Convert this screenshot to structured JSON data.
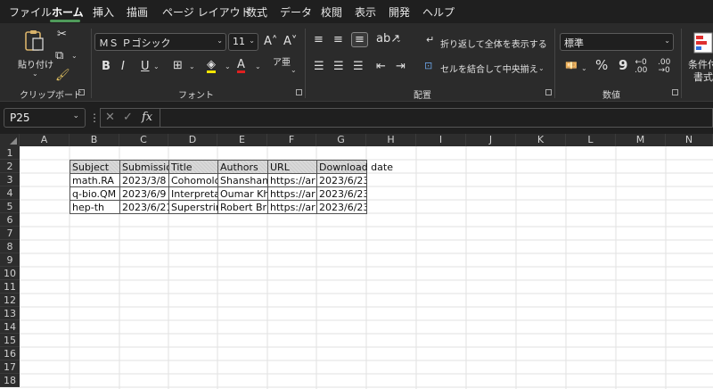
{
  "menu": {
    "items": [
      "ファイル",
      "ホーム",
      "挿入",
      "描画",
      "ページ レイアウト",
      "数式",
      "データ",
      "校閲",
      "表示",
      "開発",
      "ヘルプ"
    ],
    "active": "ホーム"
  },
  "ribbon": {
    "clipboard": {
      "paste_label": "貼り付け",
      "group_label": "クリップボード"
    },
    "font": {
      "font_name": "ＭＳ Ｐゴシック",
      "font_size": "11",
      "group_label": "フォント",
      "bold": "B",
      "italic": "I",
      "underline": "U",
      "grow": "A^",
      "shrink": "A˅"
    },
    "alignment": {
      "wrap_label": "折り返して全体を表示する",
      "merge_label": "セルを結合して中央揃え",
      "group_label": "配置"
    },
    "number": {
      "format": "標準",
      "group_label": "数値",
      "percent": "%",
      "comma": "9"
    },
    "styles": {
      "conditional_label_line1": "条件付",
      "conditional_label_line2": "書式"
    }
  },
  "formula_bar": {
    "name_box": "P25",
    "fx": "fx",
    "value": ""
  },
  "columns": [
    "A",
    "B",
    "C",
    "D",
    "E",
    "F",
    "G",
    "H",
    "I",
    "J",
    "K",
    "L",
    "M",
    "N"
  ],
  "rows": [
    "1",
    "2",
    "3",
    "4",
    "5",
    "6",
    "7",
    "8",
    "9",
    "10",
    "11",
    "12",
    "13",
    "14",
    "15",
    "16",
    "17",
    "18"
  ],
  "sheet": {
    "header": [
      "Subject",
      "Submissio",
      "Title",
      "Authors",
      "URL",
      "Download date"
    ],
    "records": [
      [
        "math.RA",
        "2023/3/8",
        "Cohomolo",
        "Shanshan",
        "https://ar",
        "2023/6/23"
      ],
      [
        "q-bio.QM",
        "2023/6/9",
        "Interpreta",
        "Oumar Kh",
        "https://ar",
        "2023/6/23"
      ],
      [
        "hep-th",
        "2023/6/21",
        "Superstrin",
        "Robert Br",
        "https://ar",
        "2023/6/23"
      ]
    ]
  },
  "colors": {
    "accent": "#4f9a5a",
    "ribbon_bg": "#2b2b2b",
    "header_bg": "#d9d9d9"
  }
}
